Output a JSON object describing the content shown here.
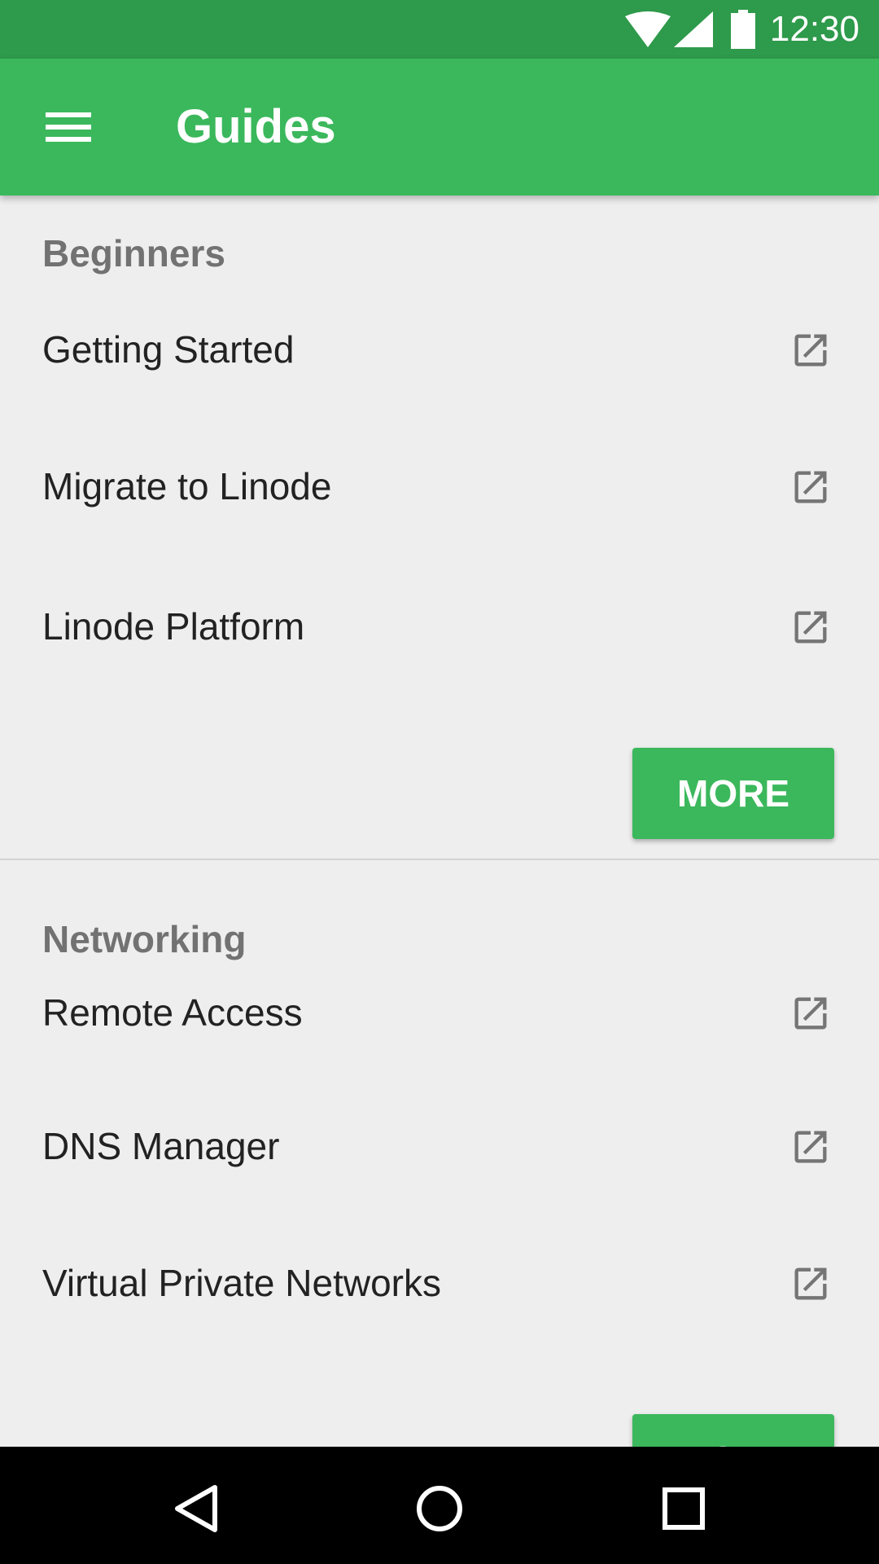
{
  "status_bar": {
    "time": "12:30",
    "icons": [
      "wifi-icon",
      "signal-icon",
      "battery-icon"
    ],
    "color": "#2e9a4b"
  },
  "app_bar": {
    "title": "Guides",
    "menu_icon": "menu-icon",
    "color": "#3bb85c"
  },
  "sections": [
    {
      "title": "Beginners",
      "items": [
        {
          "label": "Getting Started",
          "icon": "open-in-new-icon"
        },
        {
          "label": "Migrate to Linode",
          "icon": "open-in-new-icon"
        },
        {
          "label": "Linode Platform",
          "icon": "open-in-new-icon"
        }
      ],
      "more_label": "MORE"
    },
    {
      "title": "Networking",
      "items": [
        {
          "label": "Remote Access",
          "icon": "open-in-new-icon"
        },
        {
          "label": "DNS Manager",
          "icon": "open-in-new-icon"
        },
        {
          "label": "Virtual Private Networks",
          "icon": "open-in-new-icon"
        }
      ],
      "more_label": "MORE"
    }
  ],
  "nav_bar": {
    "icons": [
      "back-icon",
      "home-icon",
      "recents-icon"
    ]
  }
}
